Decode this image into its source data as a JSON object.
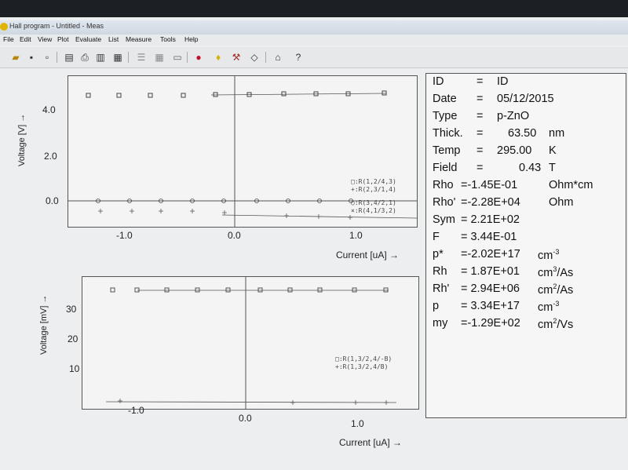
{
  "window": {
    "title": "Hall program - Untitled - Meas"
  },
  "menu": [
    "File",
    "Edit",
    "View",
    "Plot",
    "Evaluate",
    "List",
    "Measure",
    "Tools",
    "Help"
  ],
  "toolbar_icons": [
    "open-folder-icon",
    "save-icon",
    "new-page-icon",
    "print-preview-icon",
    "print-icon",
    "print-setup-icon",
    "export-icon",
    "list-icon",
    "grid-icon",
    "table-icon",
    "record-icon",
    "bulb-icon",
    "hammer-icon",
    "eraser-icon",
    "camera-icon",
    "help-icon"
  ],
  "plot_top": {
    "ylabel": "Voltage [V]  →",
    "xlabel": "Current [uA]  →",
    "yticks": [
      "4.0",
      "2.0",
      "0.0"
    ],
    "xticks": [
      "-1.0",
      "0.0",
      "1.0"
    ],
    "legend": [
      "□:R(1,2/4,3)",
      "+:R(2,3/1,4)",
      "○:R(3,4/2,1)",
      "×:R(4,1/3,2)"
    ]
  },
  "plot_bottom": {
    "ylabel": "Voltage [mV]  →",
    "xlabel": "Current [uA]  →",
    "yticks": [
      "30",
      "20",
      "10"
    ],
    "xticks": [
      "-1.0",
      "0.0",
      "1.0"
    ],
    "legend": [
      "□:R(1,3/2,4/-B)",
      "+:R(1,3/2,4/B)"
    ]
  },
  "info": {
    "id": {
      "key": "ID",
      "sep": "=",
      "value": "ID"
    },
    "date": {
      "key": "Date",
      "sep": "=",
      "value": "05/12/2015"
    },
    "type": {
      "key": "Type",
      "sep": "=",
      "value": "p-ZnO"
    },
    "thick": {
      "key": "Thick.",
      "sep": "=",
      "value": "63.50",
      "unit": "nm"
    },
    "temp": {
      "key": "Temp",
      "sep": "=",
      "value": "295.00",
      "unit": "K"
    },
    "field": {
      "key": "Field",
      "sep": "=",
      "value": "0.43",
      "unit": "T"
    },
    "rho": {
      "key": "Rho",
      "value": "=-1.45E-01",
      "unit": "Ohm*cm"
    },
    "rho2": {
      "key": "Rho'",
      "value": "=-2.28E+04",
      "unit": "Ohm"
    },
    "sym": {
      "key": "Sym",
      "value": "= 2.21E+02"
    },
    "f": {
      "key": "F",
      "value": "= 3.44E-01"
    },
    "pstar": {
      "key": "p*",
      "value": "=-2.02E+17",
      "unit": "cm",
      "unit_sup": "-3"
    },
    "rh": {
      "key": "Rh",
      "value": "= 1.87E+01",
      "unit": "cm",
      "unit_sup": "3",
      "unit_tail": "/As"
    },
    "rh2": {
      "key": "Rh'",
      "value": "= 2.94E+06",
      "unit": "cm",
      "unit_sup": "2",
      "unit_tail": "/As"
    },
    "p": {
      "key": "p",
      "value": "= 3.34E+17",
      "unit": "cm",
      "unit_sup": "-3"
    },
    "my": {
      "key": "my",
      "value": "=-1.29E+02",
      "unit": "cm",
      "unit_sup": "2",
      "unit_tail": "/Vs"
    }
  }
}
